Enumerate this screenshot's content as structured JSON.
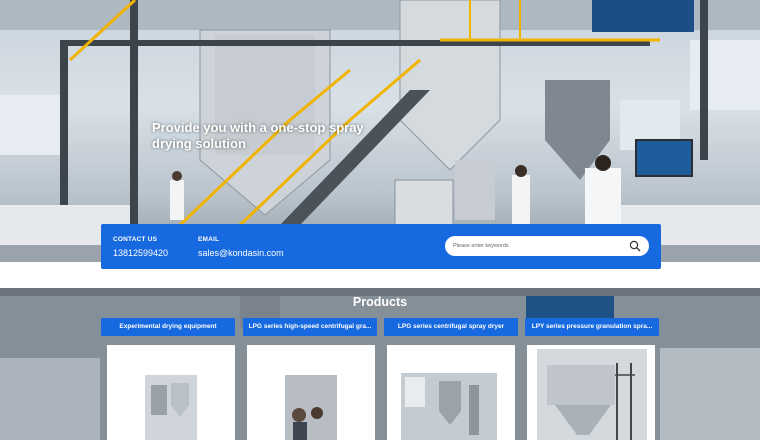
{
  "hero": {
    "title": "Provide you with a one-stop spray drying solution"
  },
  "contact": {
    "phone_label": "CONTACT US",
    "phone": "13812599420",
    "email_label": "EMAIL",
    "email": "sales@kondasin.com"
  },
  "search": {
    "placeholder": "Please enter keywords",
    "icon": "search-icon"
  },
  "products": {
    "title": "Products",
    "tabs": [
      {
        "label": "Experimental drying equipment"
      },
      {
        "label": "LPG series high-speed centrifugal gra..."
      },
      {
        "label": "LPG series centrifugal spray dryer"
      },
      {
        "label": "LPY series pressure granulation spra..."
      }
    ]
  },
  "colors": {
    "accent": "#1769e0",
    "white": "#ffffff"
  }
}
